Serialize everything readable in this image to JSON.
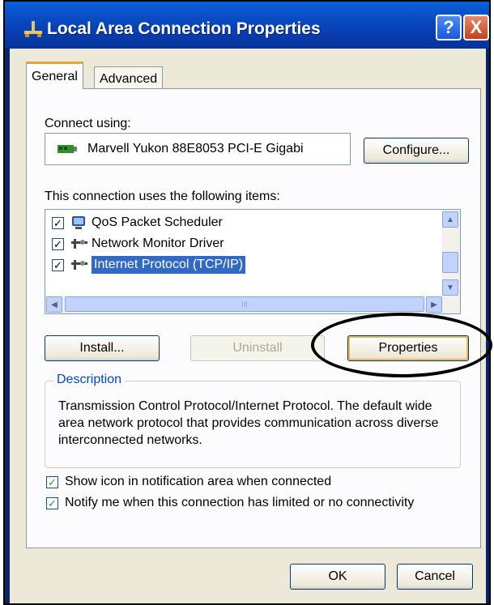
{
  "window": {
    "title": "Local Area Connection Properties",
    "help_label": "?",
    "close_label": "X"
  },
  "tabs": [
    {
      "label": "General",
      "active": true
    },
    {
      "label": "Advanced",
      "active": false
    }
  ],
  "general": {
    "connect_using_label": "Connect using:",
    "adapter_name": "Marvell Yukon 88E8053 PCI-E Gigabi",
    "configure_label": "Configure...",
    "items_label": "This connection uses the following items:",
    "items": [
      {
        "label": "QoS Packet Scheduler",
        "checked": true,
        "icon": "scheduler-icon"
      },
      {
        "label": "Network Monitor Driver",
        "checked": true,
        "icon": "protocol-icon"
      },
      {
        "label": "Internet Protocol (TCP/IP)",
        "checked": true,
        "icon": "protocol-icon",
        "selected": true
      }
    ],
    "hscroll_grip": "III",
    "install_label": "Install...",
    "uninstall_label": "Uninstall",
    "properties_label": "Properties",
    "description_title": "Description",
    "description_text": "Transmission Control Protocol/Internet Protocol. The default wide area network protocol that provides communication across diverse interconnected networks.",
    "options": [
      {
        "label": "Show icon in notification area when connected",
        "checked": true
      },
      {
        "label": "Notify me when this connection has limited or no connectivity",
        "checked": true
      }
    ]
  },
  "footer": {
    "ok_label": "OK",
    "cancel_label": "Cancel"
  },
  "colors": {
    "title_bar": "#0842b8",
    "dialog_bg": "#ece9d8",
    "selection": "#316ac5",
    "group_title": "#0046d5",
    "tab_highlight": "#e8a33d"
  }
}
